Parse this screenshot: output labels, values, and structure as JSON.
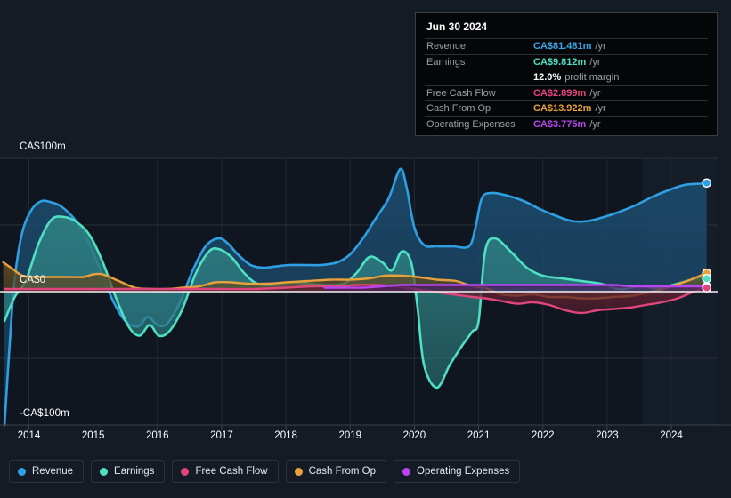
{
  "background": "#151b24",
  "plot_background": "#101620",
  "tooltip": {
    "date": "Jun 30 2024",
    "rows": [
      {
        "key": "Revenue",
        "value": "CA$81.481m",
        "unit": "/yr",
        "color": "#3ba7e8"
      },
      {
        "key": "Earnings",
        "value": "CA$9.812m",
        "unit": "/yr",
        "color": "#4fe0c4"
      },
      {
        "key": "",
        "value": "12.0%",
        "unit": "profit margin",
        "color": "#ffffff"
      },
      {
        "key": "Free Cash Flow",
        "value": "CA$2.899m",
        "unit": "/yr",
        "color": "#e8437f"
      },
      {
        "key": "Cash From Op",
        "value": "CA$13.922m",
        "unit": "/yr",
        "color": "#e8a13c"
      },
      {
        "key": "Operating Expenses",
        "value": "CA$3.775m",
        "unit": "/yr",
        "color": "#b944f0"
      }
    ]
  },
  "legend": {
    "items": [
      {
        "label": "Revenue",
        "color": "#2f9fe3"
      },
      {
        "label": "Earnings",
        "color": "#4fe0c4"
      },
      {
        "label": "Free Cash Flow",
        "color": "#e0467c"
      },
      {
        "label": "Cash From Op",
        "color": "#e8a13c"
      },
      {
        "label": "Operating Expenses",
        "color": "#b944f0"
      }
    ]
  },
  "chart_data": {
    "type": "line",
    "title": "",
    "xlabel": "",
    "ylabel": "",
    "currency": "CA$",
    "grid": true,
    "legend_position": "bottom",
    "ylim": [
      -100,
      100
    ],
    "ytick_labels": [
      "CA$100m",
      "CA$0",
      "-CA$100m"
    ],
    "ytick_values": [
      100,
      0,
      -100
    ],
    "gridline_values": [
      100,
      50,
      -50
    ],
    "zero_line_value": 0,
    "xlim": [
      2013.55,
      2024.72
    ],
    "xtick_labels": [
      "2014",
      "2015",
      "2016",
      "2017",
      "2018",
      "2019",
      "2020",
      "2021",
      "2022",
      "2023",
      "2024"
    ],
    "xtick_values": [
      2014,
      2015,
      2016,
      2017,
      2018,
      2019,
      2020,
      2021,
      2022,
      2023,
      2024
    ],
    "series": [
      {
        "name": "Revenue",
        "color": "#2f9fe3",
        "fill": "#1b4a6b",
        "x": [
          2013.62,
          2013.7,
          2013.78,
          2013.9,
          2014.05,
          2014.2,
          2014.35,
          2014.5,
          2014.7,
          2014.9,
          2015.1,
          2015.3,
          2015.5,
          2015.7,
          2015.85,
          2016.0,
          2016.15,
          2016.35,
          2016.55,
          2016.75,
          2016.95,
          2017.1,
          2017.25,
          2017.45,
          2017.65,
          2017.85,
          2018.05,
          2018.3,
          2018.55,
          2018.8,
          2019.0,
          2019.2,
          2019.4,
          2019.6,
          2019.78,
          2019.88,
          2020.0,
          2020.15,
          2020.35,
          2020.6,
          2020.85,
          2020.95,
          2021.05,
          2021.2,
          2021.45,
          2021.7,
          2021.95,
          2022.2,
          2022.45,
          2022.7,
          2022.95,
          2023.2,
          2023.45,
          2023.7,
          2023.95,
          2024.2,
          2024.45,
          2024.55
        ],
        "y": [
          -100,
          -40,
          10,
          45,
          62,
          68,
          67,
          64,
          55,
          40,
          18,
          -6,
          -22,
          -26,
          -19,
          -25,
          -24,
          -8,
          16,
          34,
          40,
          36,
          28,
          20,
          18,
          19,
          20,
          20,
          20,
          22,
          28,
          40,
          55,
          70,
          92,
          78,
          48,
          35,
          34,
          34,
          34,
          48,
          70,
          74,
          72,
          68,
          62,
          57,
          53,
          53,
          56,
          60,
          65,
          71,
          76,
          80,
          81,
          81
        ]
      },
      {
        "name": "Earnings",
        "color": "#4fe0c4",
        "fill": "#2d7d80",
        "x": [
          2013.62,
          2013.78,
          2013.95,
          2014.15,
          2014.35,
          2014.55,
          2014.75,
          2014.95,
          2015.15,
          2015.35,
          2015.55,
          2015.72,
          2015.88,
          2016.02,
          2016.18,
          2016.38,
          2016.6,
          2016.8,
          2016.95,
          2017.15,
          2017.35,
          2017.55,
          2017.8,
          2018.05,
          2018.35,
          2018.65,
          2018.9,
          2019.1,
          2019.3,
          2019.5,
          2019.65,
          2019.8,
          2019.95,
          2020.05,
          2020.15,
          2020.35,
          2020.55,
          2020.75,
          2020.9,
          2021.0,
          2021.1,
          2021.25,
          2021.5,
          2021.75,
          2022.0,
          2022.3,
          2022.6,
          2022.9,
          2023.2,
          2023.5,
          2023.8,
          2024.1,
          2024.4,
          2024.55
        ],
        "y": [
          -22,
          -4,
          8,
          36,
          54,
          56,
          52,
          42,
          22,
          -4,
          -26,
          -33,
          -25,
          -33,
          -30,
          -14,
          14,
          30,
          32,
          26,
          14,
          6,
          5,
          7,
          6,
          5,
          6,
          14,
          26,
          22,
          16,
          30,
          22,
          -12,
          -55,
          -72,
          -55,
          -40,
          -30,
          -22,
          30,
          40,
          30,
          18,
          12,
          10,
          8,
          6,
          2,
          4,
          3,
          6,
          10,
          10
        ]
      },
      {
        "name": "Free Cash Flow",
        "color": "#e0467c",
        "fill": "#5e2030",
        "x": [
          2013.62,
          2014.0,
          2014.5,
          2015.0,
          2015.5,
          2016.0,
          2016.5,
          2017.0,
          2017.5,
          2018.0,
          2018.4,
          2018.8,
          2019.1,
          2019.4,
          2019.7,
          2020.0,
          2020.3,
          2020.6,
          2020.9,
          2021.1,
          2021.35,
          2021.6,
          2021.85,
          2022.1,
          2022.35,
          2022.6,
          2022.85,
          2023.1,
          2023.35,
          2023.6,
          2023.85,
          2024.1,
          2024.35,
          2024.55
        ],
        "y": [
          2,
          2,
          2,
          2,
          2,
          2,
          2,
          2,
          2,
          3,
          4,
          4,
          5,
          5,
          4,
          2,
          0,
          -2,
          -4,
          -5,
          -7,
          -9,
          -8,
          -10,
          -14,
          -16,
          -14,
          -13,
          -12,
          -10,
          -8,
          -5,
          0,
          3
        ]
      },
      {
        "name": "Cash From Op",
        "color": "#e8a13c",
        "fill": "#5e4a22",
        "x": [
          2013.6,
          2013.72,
          2013.9,
          2014.1,
          2014.35,
          2014.6,
          2014.85,
          2015.0,
          2015.15,
          2015.4,
          2015.65,
          2015.9,
          2016.15,
          2016.4,
          2016.65,
          2016.9,
          2017.15,
          2017.4,
          2017.7,
          2018.0,
          2018.35,
          2018.7,
          2019.0,
          2019.3,
          2019.55,
          2019.8,
          2020.05,
          2020.35,
          2020.65,
          2020.9,
          2021.1,
          2021.35,
          2021.6,
          2021.85,
          2022.1,
          2022.35,
          2022.6,
          2022.85,
          2023.1,
          2023.4,
          2023.7,
          2024.0,
          2024.3,
          2024.55
        ],
        "y": [
          22,
          18,
          12,
          11,
          11,
          11,
          11,
          13,
          13,
          8,
          3,
          2,
          2,
          3,
          4,
          7,
          7,
          6,
          6,
          7,
          8,
          9,
          9,
          10,
          12,
          12,
          11,
          9,
          8,
          4,
          3,
          -2,
          -3,
          -2,
          -4,
          -4,
          -5,
          -5,
          -4,
          -3,
          0,
          4,
          9,
          14
        ]
      },
      {
        "name": "Operating Expenses",
        "color": "#b944f0",
        "fill": "#4a2060",
        "x": [
          2018.6,
          2018.9,
          2019.2,
          2019.5,
          2019.8,
          2020.1,
          2020.4,
          2020.7,
          2021.0,
          2021.3,
          2021.6,
          2021.9,
          2022.2,
          2022.5,
          2022.8,
          2023.1,
          2023.4,
          2023.7,
          2024.0,
          2024.3,
          2024.55
        ],
        "y": [
          3,
          3,
          3,
          4,
          5,
          5,
          5,
          5,
          5,
          5,
          5,
          5,
          5,
          5,
          5,
          5,
          4,
          4,
          4,
          4,
          4
        ]
      }
    ],
    "end_markers": [
      {
        "series": "Revenue",
        "x": 2024.55,
        "y": 81.481,
        "color": "#2f9fe3"
      },
      {
        "series": "Cash From Op",
        "x": 2024.55,
        "y": 13.922,
        "color": "#e8a13c"
      },
      {
        "series": "Earnings",
        "x": 2024.55,
        "y": 9.812,
        "color": "#4fe0c4"
      },
      {
        "series": "Operating Expenses",
        "x": 2024.55,
        "y": 3.775,
        "color": "#b944f0"
      },
      {
        "series": "Free Cash Flow",
        "x": 2024.55,
        "y": 2.899,
        "color": "#e0467c"
      }
    ],
    "forecast_band": {
      "from": 2023.55,
      "to": 2024.72
    }
  }
}
